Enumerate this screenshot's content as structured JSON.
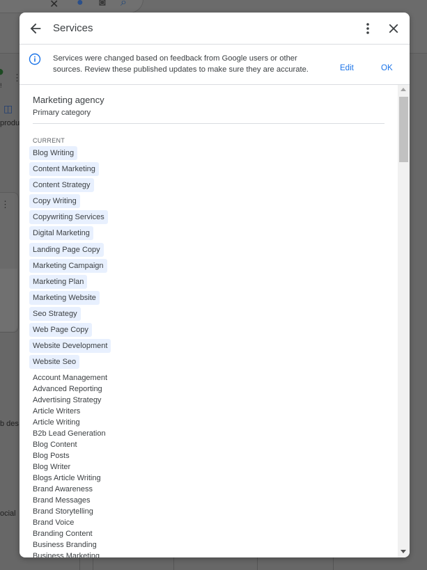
{
  "background": {
    "snippets": [
      "!",
      "produ",
      "b des",
      "ocial"
    ]
  },
  "dialog": {
    "title": "Services",
    "banner": {
      "text": "Services were changed based on feedback from Google users or other sources. Review these published updates to make sure they are accurate.",
      "edit_label": "Edit",
      "ok_label": "OK"
    },
    "category": {
      "name": "Marketing agency",
      "subtitle": "Primary category"
    },
    "current_label": "CURRENT",
    "current_services": [
      "Blog Writing",
      "Content Marketing",
      "Content Strategy",
      "Copy Writing",
      "Copywriting Services",
      "Digital Marketing",
      "Landing Page Copy",
      "Marketing Campaign",
      "Marketing Plan",
      "Marketing Website",
      "Seo Strategy",
      "Web Page Copy",
      "Website Development",
      "Website Seo"
    ],
    "other_services": [
      "Account Management",
      "Advanced Reporting",
      "Advertising Strategy",
      "Article Writers",
      "Article Writing",
      "B2b Lead Generation",
      "Blog Content",
      "Blog Posts",
      "Blog Writer",
      "Blogs Article Writing",
      "Brand Awareness",
      "Brand Messages",
      "Brand Storytelling",
      "Brand Voice",
      "Branding Content",
      "Business Branding",
      "Business Marketing"
    ]
  },
  "colors": {
    "accent": "#1a73e8",
    "chip_bg": "#e8f0fe",
    "scrim": "#676767"
  }
}
